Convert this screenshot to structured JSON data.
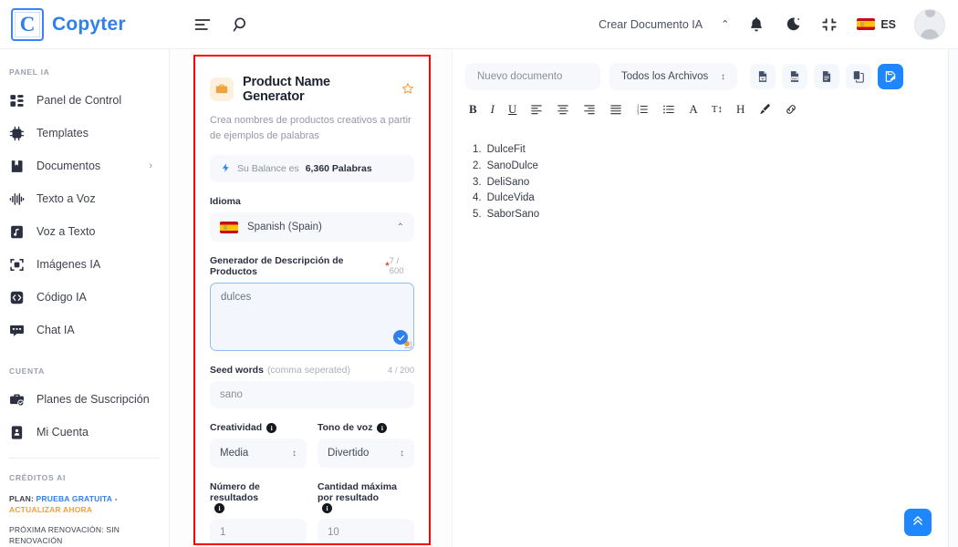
{
  "brand": {
    "logo_letter": "C",
    "name": "Copyter"
  },
  "topbar": {
    "menu_icon": "menu-icon",
    "search_icon": "search-icon",
    "create_document": "Crear Documento IA",
    "chevron": "⌃",
    "bell_icon": "bell-icon",
    "dark_mode_icon": "moon-icon",
    "fullscreen_icon": "compress-icon",
    "language_code": "ES",
    "avatar": "user-avatar"
  },
  "sidebar": {
    "section_panel": "PANEL IA",
    "items": [
      {
        "label": "Panel de Control",
        "icon": "dashboard-icon"
      },
      {
        "label": "Templates",
        "icon": "chip-ai-icon"
      },
      {
        "label": "Documentos",
        "icon": "book-icon",
        "arrow": "›"
      },
      {
        "label": "Texto a Voz",
        "icon": "waveform-icon"
      },
      {
        "label": "Voz a Texto",
        "icon": "audio-file-icon"
      },
      {
        "label": "Imágenes IA",
        "icon": "camera-icon"
      },
      {
        "label": "Código IA",
        "icon": "code-icon"
      },
      {
        "label": "Chat IA",
        "icon": "chat-icon"
      }
    ],
    "section_account": "CUENTA",
    "account_items": [
      {
        "label": "Planes de Suscripción",
        "icon": "briefcase-check-icon"
      },
      {
        "label": "Mi Cuenta",
        "icon": "id-card-icon"
      }
    ],
    "section_credits": "CRÉDITOS AI",
    "plan_prefix": "PLAN:",
    "plan_value": "PRUEBA GRATUITA",
    "plan_dash": "-",
    "plan_upgrade": "ACTUALIZAR AHORA",
    "renewal": "PRÓXIMA RENOVACIÓN: SIN RENOVACIÓN"
  },
  "form": {
    "badge_icon": "briefcase-icon",
    "title": "Product Name Generator",
    "star_icon": "star-icon",
    "description": "Crea nombres de productos creativos a partir de ejemplos de palabras",
    "balance_prefix": "Su Balance es",
    "balance_value": "6,360 Palabras",
    "bolt_icon": "bolt-icon",
    "language_label": "Idioma",
    "language_value": "Spanish (Spain)",
    "language_caret": "⌃",
    "prompt_label": "Generador de Descripción de Productos",
    "prompt_required": "*",
    "prompt_counter": "7 / 600",
    "prompt_value": "dulces",
    "seed_label": "Seed words",
    "seed_sublabel": "(comma seperated)",
    "seed_counter": "4 / 200",
    "seed_value": "sano",
    "creativity_label": "Creatividad",
    "creativity_value": "Media",
    "tone_label": "Tono de voz",
    "tone_value": "Divertido",
    "results_label": "Número de resultados",
    "results_value": "1",
    "maxlen_label": "Cantidad máxima por resultado",
    "maxlen_value": "10",
    "info_icon": "info-icon",
    "highlight_color": "#ff0000"
  },
  "editor": {
    "doc_name_placeholder": "Nuevo documento",
    "filter_value": "Todos los Archivos",
    "filter_caret": "↕",
    "actions": [
      {
        "name": "export-word-button",
        "icon": "word-file-icon"
      },
      {
        "name": "export-pdf-button",
        "icon": "pdf-file-icon"
      },
      {
        "name": "export-text-button",
        "icon": "text-file-icon"
      },
      {
        "name": "copy-button",
        "icon": "copy-icon"
      },
      {
        "name": "save-document-button",
        "icon": "save-doc-icon"
      }
    ],
    "format_tools": [
      {
        "name": "bold-button",
        "glyph": "B"
      },
      {
        "name": "italic-button",
        "glyph": "I"
      },
      {
        "name": "underline-button",
        "glyph": "U"
      },
      {
        "name": "align-left-button",
        "glyph": "align-left-icon"
      },
      {
        "name": "align-center-button",
        "glyph": "align-center-icon"
      },
      {
        "name": "align-right-button",
        "glyph": "align-right-icon"
      },
      {
        "name": "align-justify-button",
        "glyph": "align-justify-icon"
      },
      {
        "name": "ordered-list-button",
        "glyph": "ordered-list-icon"
      },
      {
        "name": "unordered-list-button",
        "glyph": "unordered-list-icon"
      },
      {
        "name": "font-color-button",
        "glyph": "A"
      },
      {
        "name": "font-size-button",
        "glyph": "T↕"
      },
      {
        "name": "heading-button",
        "glyph": "H"
      },
      {
        "name": "highlight-button",
        "glyph": "brush-icon"
      },
      {
        "name": "link-button",
        "glyph": "link-icon"
      }
    ],
    "results": [
      {
        "num": "1.",
        "text": "DulceFit"
      },
      {
        "num": "2.",
        "text": "SanoDulce"
      },
      {
        "num": "3.",
        "text": "DeliSano"
      },
      {
        "num": "4.",
        "text": "DulceVida"
      },
      {
        "num": "5.",
        "text": "SaborSano"
      }
    ],
    "scroll_top_icon": "double-chevron-up-icon"
  },
  "colors": {
    "accent": "#1e86ff",
    "brand": "#2f80ed",
    "warning": "#f3a13a",
    "highlight": "#ff0000"
  }
}
